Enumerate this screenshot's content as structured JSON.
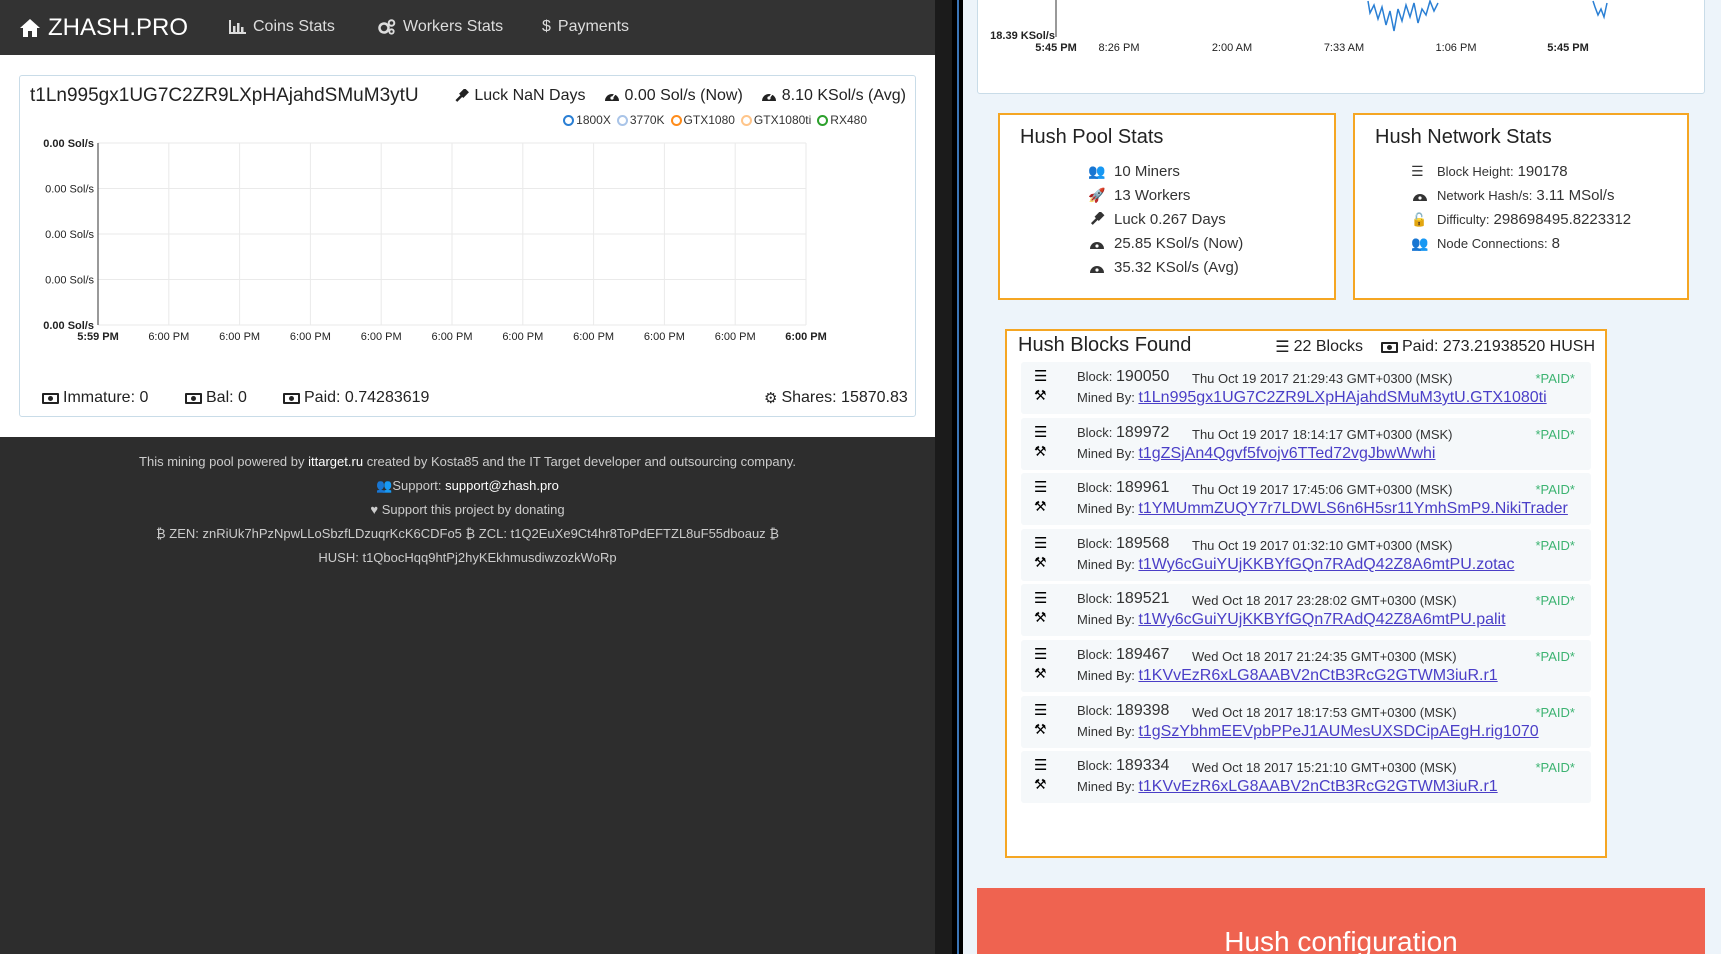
{
  "nav": {
    "brand": "ZHASH.PRO",
    "links": [
      "Coins Stats",
      "Workers Stats",
      "Payments"
    ]
  },
  "worker": {
    "address": "t1Ln995gx1UG7C2ZR9LXpHAjahdSMuM3ytU",
    "luck": "Luck NaN Days",
    "hashrate_now": "0.00 Sol/s (Now)",
    "hashrate_avg": "8.10 KSol/s (Avg)",
    "immature": "Immature: 0",
    "balance": "Bal: 0",
    "paid": "Paid: 0.74283619",
    "shares": "Shares: 15870.83"
  },
  "colors": {
    "nav_bg": "#333333",
    "accent_border": "#f5a623",
    "paid_green": "#3cb371",
    "link_purple": "#4a3ec7",
    "banner_red": "#ef6350"
  },
  "chart_data": {
    "type": "line",
    "legend": [
      {
        "name": "1800X",
        "color": "#2a7fd4"
      },
      {
        "name": "3770K",
        "color": "#a9c4e8"
      },
      {
        "name": "GTX1080",
        "color": "#ff8c1a"
      },
      {
        "name": "GTX1080ti",
        "color": "#ffc58a"
      },
      {
        "name": "RX480",
        "color": "#2ca02c"
      }
    ],
    "y_ticks": [
      "0.00 Sol/s",
      "0.00 Sol/s",
      "0.00 Sol/s",
      "0.00 Sol/s",
      "0.00 Sol/s"
    ],
    "x_ticks": [
      "5:59 PM",
      "6:00 PM",
      "6:00 PM",
      "6:00 PM",
      "6:00 PM",
      "6:00 PM",
      "6:00 PM",
      "6:00 PM",
      "6:00 PM",
      "6:00 PM",
      "6:00 PM"
    ],
    "series": [],
    "grid": true,
    "legend_position": "top-right"
  },
  "top_chart": {
    "y_label": "18.39 KSol/s",
    "x_ticks": [
      "5:45 PM",
      "8:26 PM",
      "2:00 AM",
      "7:33 AM",
      "1:06 PM",
      "5:45 PM"
    ]
  },
  "footer": {
    "powered_pre": "This mining pool powered by",
    "powered_site": "ittarget.ru",
    "powered_post": "created by Kosta85 and the IT Target developer and outsourcing company.",
    "support_label": "Support:",
    "support_email": "support@zhash.pro",
    "donate": "Support this project by donating",
    "zen": "ZEN: znRiUk7hPzNpwLLoSbzfLDzuqrKcK6CDFo5",
    "zcl": "ZCL: t1Q2EuXe9Ct4hr8ToPdEFTZL8uF55dboauz",
    "hush": "HUSH: t1QbocHqq9htPj2hyKEkhmusdiwzozkWoRp"
  },
  "pool_stats": {
    "title": "Hush Pool Stats",
    "miners": "10 Miners",
    "workers": "13 Workers",
    "luck": "Luck 0.267 Days",
    "hash_now": "25.85 KSol/s (Now)",
    "hash_avg": "35.32 KSol/s (Avg)"
  },
  "network_stats": {
    "title": "Hush Network Stats",
    "height_label": "Block Height:",
    "height": "190178",
    "hash_label": "Network Hash/s:",
    "hash": "3.11 MSol/s",
    "diff_label": "Difficulty:",
    "diff": "298698495.8223312",
    "conn_label": "Node Connections:",
    "conn": "8"
  },
  "blocks": {
    "title": "Hush Blocks Found",
    "count": "22 Blocks",
    "paid": "Paid: 273.21938520 HUSH",
    "block_label": "Block:",
    "mined_label": "Mined By:",
    "rows": [
      {
        "number": "190050",
        "date": "Thu Oct 19 2017 21:29:43 GMT+0300 (MSK)",
        "status": "*PAID*",
        "miner": "t1Ln995gx1UG7C2ZR9LXpHAjahdSMuM3ytU.GTX1080ti"
      },
      {
        "number": "189972",
        "date": "Thu Oct 19 2017 18:14:17 GMT+0300 (MSK)",
        "status": "*PAID*",
        "miner": "t1gZSjAn4Qgvf5fvojv6TTed72vgJbwWwhi"
      },
      {
        "number": "189961",
        "date": "Thu Oct 19 2017 17:45:06 GMT+0300 (MSK)",
        "status": "*PAID*",
        "miner": "t1YMUmmZUQY7r7LDWLS6n6H5sr11YmhSmP9.NikiTrader"
      },
      {
        "number": "189568",
        "date": "Thu Oct 19 2017 01:32:10 GMT+0300 (MSK)",
        "status": "*PAID*",
        "miner": "t1Wy6cGuiYUjKKBYfGQn7RAdQ42Z8A6mtPU.zotac"
      },
      {
        "number": "189521",
        "date": "Wed Oct 18 2017 23:28:02 GMT+0300 (MSK)",
        "status": "*PAID*",
        "miner": "t1Wy6cGuiYUjKKBYfGQn7RAdQ42Z8A6mtPU.palit"
      },
      {
        "number": "189467",
        "date": "Wed Oct 18 2017 21:24:35 GMT+0300 (MSK)",
        "status": "*PAID*",
        "miner": "t1KVvEzR6xLG8AABV2nCtB3RcG2GTWM3iuR.r1"
      },
      {
        "number": "189398",
        "date": "Wed Oct 18 2017 18:17:53 GMT+0300 (MSK)",
        "status": "*PAID*",
        "miner": "t1gSzYbhmEEVpbPPeJ1AUMesUXSDCipAEgH.rig1070"
      },
      {
        "number": "189334",
        "date": "Wed Oct 18 2017 15:21:10 GMT+0300 (MSK)",
        "status": "*PAID*",
        "miner": "t1KVvEzR6xLG8AABV2nCtB3RcG2GTWM3iuR.r1"
      }
    ]
  },
  "config_banner": "Hush configuration"
}
